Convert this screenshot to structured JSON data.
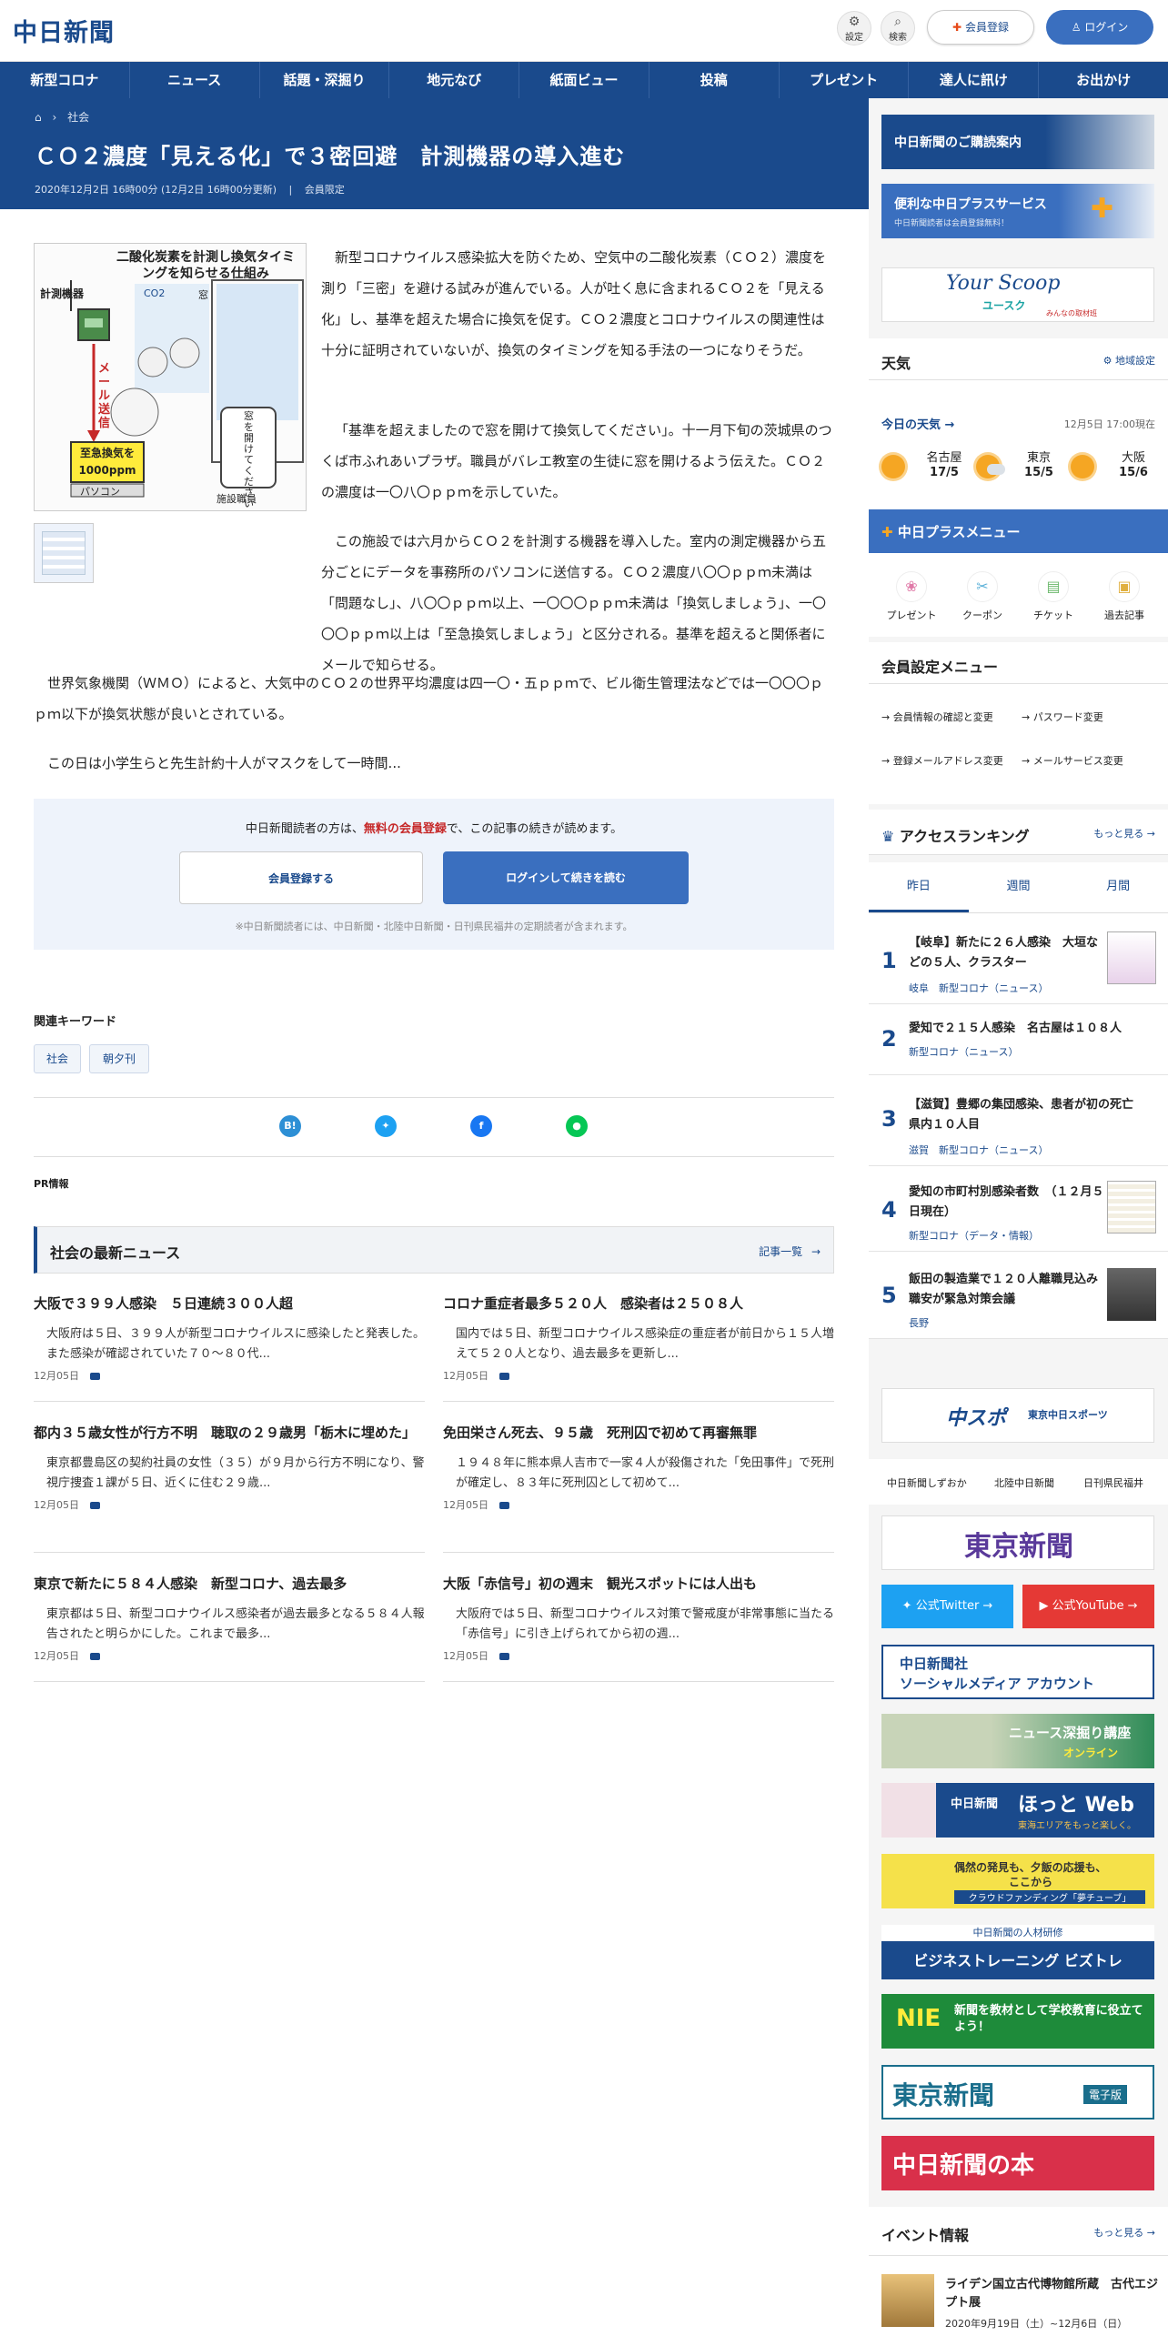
{
  "header": {
    "logo": "中日新聞",
    "settings_label": "設定",
    "search_label": "検索",
    "register_label": "会員登録",
    "login_label": "ログイン"
  },
  "nav": [
    "新型コロナ",
    "ニュース",
    "話題・深掘り",
    "地元なび",
    "紙面ビュー",
    "投稿",
    "プレゼント",
    "達人に訊け",
    "お出かけ"
  ],
  "breadcrumb": {
    "category": "社会"
  },
  "article": {
    "title": "ＣＯ２濃度「見える化」で３密回避　計測機器の導入進む",
    "date": "2020年12月2日 16時00分 (12月2日 16時00分更新)",
    "member": "会員限定",
    "figure": {
      "title": "二酸化炭素を計測し換気タイミングを知らせる仕組み",
      "labels": [
        "計測機器",
        "CO2",
        "窓",
        "メール送信",
        "窓を開けてください",
        "至急換気を1000ppm",
        "パソコン",
        "施設職員"
      ]
    },
    "p1": "新型コロナウイルス感染拡大を防ぐため、空気中の二酸化炭素（ＣＯ２）濃度を測り「三密」を避ける試みが進んでいる。人が吐く息に含まれるＣＯ２を「見える化」し、基準を超えた場合に換気を促す。ＣＯ２濃度とコロナウイルスの関連性は十分に証明されていないが、換気のタイミングを知る手法の一つになりそうだ。",
    "p2": "「基準を超えましたので窓を開けて換気してください」。十一月下旬の茨城県のつくば市ふれあいプラザ。職員がバレエ教室の生徒に窓を開けるよう伝えた。ＣＯ２の濃度は一〇八〇ｐｐｍを示していた。",
    "p3": "この施設では六月からＣＯ２を計測する機器を導入した。室内の測定機器から五分ごとにデータを事務所のパソコンに送信する。ＣＯ２濃度八〇〇ｐｐｍ未満は「問題なし」、八〇〇ｐｐｍ以上、一〇〇〇ｐｐｍ未満は「換気しましょう」、一〇〇〇ｐｐｍ以上は「至急換気しましょう」と区分される。基準を超えると関係者にメールで知らせる。",
    "p4": "世界気象機関（ＷＭＯ）によると、大気中のＣＯ２の世界平均濃度は四一〇・五ｐｐｍで、ビル衛生管理法などでは一〇〇〇ｐｐｍ以下が換気状態が良いとされている。",
    "p5": "この日は小学生らと先生計約十人がマスクをして一時間..."
  },
  "paywall": {
    "text_before": "中日新聞読者の方は、",
    "text_link": "無料の会員登録",
    "text_after": "で、この記事の続きが読めます。",
    "register_button": "会員登録する",
    "login_button": "ログインして続きを読む",
    "note": "※中日新聞読者には、中日新聞・北陸中日新聞・日刊県民福井の定期読者が含まれます。"
  },
  "keywords": {
    "heading": "関連キーワード",
    "items": [
      "社会",
      "朝夕刊"
    ]
  },
  "share": {
    "hatena": "B!"
  },
  "pr_label": "PR情報",
  "latest": {
    "heading": "社会の最新ニュース",
    "more": "記事一覧",
    "items": [
      {
        "title": "大阪で３９９人感染　５日連続３００人超",
        "desc": "大阪府は５日、３９９人が新型コロナウイルスに感染したと発表した。また感染が確認されていた７０～８０代...",
        "date": "12月05日"
      },
      {
        "title": "コロナ重症者最多５２０人　感染者は２５０８人",
        "desc": "国内では５日、新型コロナウイルス感染症の重症者が前日から１５人増えて５２０人となり、過去最多を更新し...",
        "date": "12月05日"
      },
      {
        "title": "都内３５歳女性が行方不明　聴取の２９歳男「栃木に埋めた」",
        "desc": "東京都豊島区の契約社員の女性（３５）が９月から行方不明になり、警視庁捜査１課が５日、近くに住む２９歳...",
        "date": "12月05日"
      },
      {
        "title": "免田栄さん死去、９５歳　死刑囚で初めて再審無罪",
        "desc": "１９４８年に熊本県人吉市で一家４人が殺傷された「免田事件」で死刑が確定し、８３年に死刑囚として初めて...",
        "date": "12月05日"
      },
      {
        "title": "東京で新たに５８４人感染　新型コロナ、過去最多",
        "desc": "東京都は５日、新型コロナウイルス感染者が過去最多となる５８４人報告されたと明らかにした。これまで最多...",
        "date": "12月05日"
      },
      {
        "title": "大阪「赤信号」初の週末　観光スポットには人出も",
        "desc": "大阪府では５日、新型コロナウイルス対策で警戒度が非常事態に当たる「赤信号」に引き上げられてから初の週...",
        "date": "12月05日"
      }
    ]
  },
  "sidebar": {
    "banner1": "中日新聞のご購読案内",
    "banner2_title": "便利な中日プラスサービス",
    "banner2_sub": "中日新聞読者は会員登録無料！",
    "banner3": "Your Scoop",
    "banner3_sub": "ユースク",
    "banner3_note": "みんなの取材班",
    "weather": {
      "heading": "天気",
      "setting": "地域設定",
      "today": "今日の天気",
      "time": "12月5日 17:00現在",
      "cities": [
        {
          "name": "名古屋",
          "temp": "17/5"
        },
        {
          "name": "東京",
          "temp": "15/5"
        },
        {
          "name": "大阪",
          "temp": "15/6"
        }
      ]
    },
    "plus_menu": {
      "heading": "中日プラスメニュー",
      "items": [
        "プレゼント",
        "クーポン",
        "チケット",
        "過去記事"
      ]
    },
    "member_menu": {
      "heading": "会員設定メニュー",
      "items": [
        "会員情報の確認と変更",
        "パスワード変更",
        "登録メールアドレス変更",
        "メールサービス変更"
      ]
    },
    "ranking": {
      "heading": "アクセスランキング",
      "more": "もっと見る",
      "tabs": [
        "昨日",
        "週間",
        "月間"
      ],
      "items": [
        {
          "rank": "1",
          "title": "【岐阜】新たに２６人感染　大垣などの５人、クラスター",
          "cat": "岐阜　新型コロナ（ニュース）"
        },
        {
          "rank": "2",
          "title": "愛知で２１５人感染　名古屋は１０８人",
          "cat": "新型コロナ（ニュース）"
        },
        {
          "rank": "3",
          "title": "【滋賀】豊郷の集団感染、患者が初の死亡　県内１０人目",
          "cat": "滋賀　新型コロナ（ニュース）"
        },
        {
          "rank": "4",
          "title": "愛知の市町村別感染者数　（１２月５日現在）",
          "cat": "新型コロナ（データ・情報）"
        },
        {
          "rank": "5",
          "title": "飯田の製造業で１２０人離職見込み　職安が緊急対策会議",
          "cat": "長野"
        }
      ]
    },
    "banner_chuspo": "中スポ",
    "banner_chuspo2": "東京中日スポーツ",
    "links": [
      "中日新聞しずおか",
      "北陸中日新聞",
      "日刊県民福井"
    ],
    "banner_tokyo": "東京新聞",
    "twitter": "公式Twitter",
    "youtube": "公式YouTube",
    "social_line1": "中日新聞社",
    "social_line2": "ソーシャルメディア アカウント",
    "fukabori": "ニュース深掘り講座",
    "fukabori_sub": "オンライン",
    "hotweb_brand": "中日新聞",
    "hotweb": "ほっと Web",
    "hotweb_sub": "東海エリアをもっと楽しく。",
    "crowd1": "偶然の発見も、夕飯の応援も、",
    "crowd2": "ここから",
    "crowd3": "クラウドファンディング「夢チューブ」",
    "biztore_top": "中日新聞の人材研修",
    "biztore": "ビジネストレーニング ビズトレ",
    "nie": "NIE",
    "nie_text": "新聞を教材として学校教育に役立てよう！",
    "tokyo_digital": "東京新聞",
    "tokyo_digital_sub": "電子版",
    "books": "中日新聞の本",
    "events": {
      "heading": "イベント情報",
      "more": "もっと見る",
      "title": "ライデン国立古代博物館所蔵　古代エジプト展",
      "date": "2020年9月19日（土）~12月6日（日）"
    }
  },
  "colors": {
    "navy": "#1a4a8c",
    "accent": "#3a6fbf",
    "red": "#c62828"
  }
}
